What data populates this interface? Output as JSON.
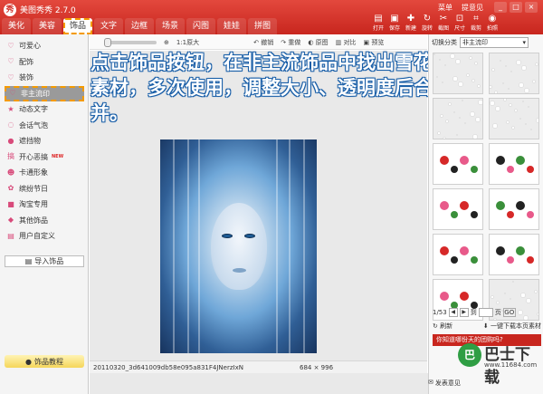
{
  "app": {
    "title": "美图秀秀 2.7.0",
    "logo_glyph": "秀"
  },
  "tabs": [
    {
      "label": "美化",
      "active": false
    },
    {
      "label": "美容",
      "active": false
    },
    {
      "label": "饰品",
      "active": true
    },
    {
      "label": "文字",
      "active": false
    },
    {
      "label": "边框",
      "active": false
    },
    {
      "label": "场景",
      "active": false
    },
    {
      "label": "闪图",
      "active": false
    },
    {
      "label": "娃娃",
      "active": false
    },
    {
      "label": "拼图",
      "active": false
    }
  ],
  "top_menu": [
    "菜单",
    "提意见"
  ],
  "window_controls": [
    "_",
    "□",
    "×"
  ],
  "top_tools": [
    {
      "label": "打开",
      "icon": "folder-icon",
      "glyph": "▤"
    },
    {
      "label": "保存",
      "icon": "save-icon",
      "glyph": "▣"
    },
    {
      "label": "新建",
      "icon": "new-icon",
      "glyph": "✚"
    },
    {
      "label": "旋转",
      "icon": "rotate-icon",
      "glyph": "↻"
    },
    {
      "label": "截图",
      "icon": "screenshot-icon",
      "glyph": "✂"
    },
    {
      "label": "尺寸",
      "icon": "resize-icon",
      "glyph": "⊡"
    },
    {
      "label": "裁剪",
      "icon": "crop-icon",
      "glyph": "⌗"
    },
    {
      "label": "拍照",
      "icon": "camera-icon",
      "glyph": "◉"
    }
  ],
  "sidebar": {
    "categories": [
      {
        "label": "可爱心",
        "icon": "heart-icon",
        "glyph": "♡",
        "selected": false,
        "is_new": false
      },
      {
        "label": "配饰",
        "icon": "accessory-icon",
        "glyph": "♡",
        "selected": false,
        "is_new": false
      },
      {
        "label": "装饰",
        "icon": "decoration-icon",
        "glyph": "♡",
        "selected": false,
        "is_new": false
      },
      {
        "label": "非主流印",
        "icon": "stamp-icon",
        "glyph": "♡",
        "selected": true,
        "is_new": false
      },
      {
        "label": "动态文字",
        "icon": "text-icon",
        "glyph": "★",
        "selected": false,
        "is_new": false
      },
      {
        "label": "会话气泡",
        "icon": "bubble-icon",
        "glyph": "◌",
        "selected": false,
        "is_new": false
      },
      {
        "label": "遮挡物",
        "icon": "cover-icon",
        "glyph": "●",
        "selected": false,
        "is_new": false
      },
      {
        "label": "开心恶搞",
        "icon": "funny-icon",
        "glyph": "搞",
        "selected": false,
        "is_new": true
      },
      {
        "label": "卡通形象",
        "icon": "cartoon-icon",
        "glyph": "☻",
        "selected": false,
        "is_new": false
      },
      {
        "label": "缤纷节日",
        "icon": "festival-icon",
        "glyph": "✿",
        "selected": false,
        "is_new": false
      },
      {
        "label": "淘宝专用",
        "icon": "taobao-icon",
        "glyph": "■",
        "selected": false,
        "is_new": false
      },
      {
        "label": "其他饰品",
        "icon": "other-icon",
        "glyph": "◆",
        "selected": false,
        "is_new": false
      },
      {
        "label": "用户自定义",
        "icon": "user-icon",
        "glyph": "▤",
        "selected": false,
        "is_new": false
      }
    ],
    "new_badge": "NEW",
    "import_label": "导入饰品",
    "tutorial_label": "饰品教程"
  },
  "canvas_toolbar": {
    "zoom_level": 0,
    "ratio_label": "1:1原大",
    "buttons": [
      "撤销",
      "重做",
      "原图",
      "对比",
      "预览"
    ]
  },
  "instruction": "点击饰品按钮，在非主流饰品中找出雪花素材，多次使用，调整大小、透明度后合并。",
  "status_bar": {
    "file_name": "20110320_3d641009db58e095a831F4JNerzIxN",
    "image_size": "684 × 996"
  },
  "right_panel": {
    "category_label": "切换分类",
    "category_value": "非主流印",
    "thumbnails": [
      {
        "name": "snowflake-thumb-1",
        "kind": "snow"
      },
      {
        "name": "snowflake-thumb-2",
        "kind": "snow"
      },
      {
        "name": "snowflake-thumb-3",
        "kind": "snow"
      },
      {
        "name": "snowflake-thumb-4",
        "kind": "snow"
      },
      {
        "name": "kiss-sticker-thumb",
        "kind": "art"
      },
      {
        "name": "couple-sticker-thumb",
        "kind": "art"
      },
      {
        "name": "love-sign-thumb",
        "kind": "art"
      },
      {
        "name": "umbrella-thumb",
        "kind": "art"
      },
      {
        "name": "hearts-thumb",
        "kind": "art"
      },
      {
        "name": "sparkle-thumb",
        "kind": "art"
      },
      {
        "name": "lips-thumb",
        "kind": "art"
      },
      {
        "name": "snowflake-thumb-5",
        "kind": "snow"
      }
    ],
    "pager": {
      "current": "1/53",
      "goto_label": "到",
      "page_suffix": "页",
      "go_label": "GO"
    },
    "refresh_label": "刷新",
    "download_label": "一键下载本页素材",
    "ad_text": "你知道哪份天的团购吗?"
  },
  "watermark": {
    "text": "巴士下载",
    "url": "www.11684.com",
    "logo_glyph": "巴"
  },
  "feedback_label": "发表意见"
}
